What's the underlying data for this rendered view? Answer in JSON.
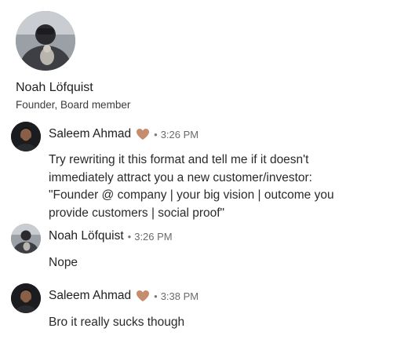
{
  "profile": {
    "name": "Noah Löfquist",
    "title": "Founder, Board member",
    "avatar_icon": "person-with-dog-photo"
  },
  "messages": [
    {
      "sender": "Saleem Ahmad",
      "badge_icon": "heart-icon",
      "badge_color": "#c58c6d",
      "separator": "•",
      "time": "3:26 PM",
      "lines": [
        "Try rewriting it this format and tell me if it doesn't",
        "immediately attract you a new customer/investor:",
        "\"Founder @ company | your big vision | outcome you",
        "provide customers | social proof\""
      ]
    },
    {
      "sender": "Noah Löfquist",
      "separator": "•",
      "time": "3:26 PM",
      "lines": [
        "Nope"
      ]
    },
    {
      "sender": "Saleem Ahmad",
      "badge_icon": "heart-icon",
      "badge_color": "#c58c6d",
      "separator": "•",
      "time": "3:38 PM",
      "lines": [
        "Bro it really sucks though"
      ]
    }
  ]
}
